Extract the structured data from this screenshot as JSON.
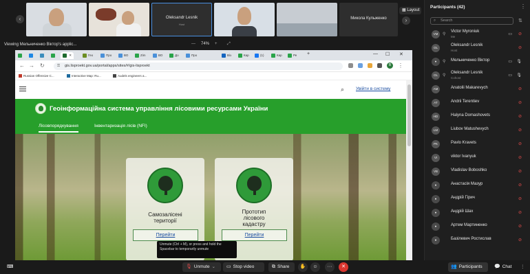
{
  "meeting": {
    "sharing_label": "Viewing Мельниченко Віктор's applic...",
    "zoom_level": "74%",
    "layout_label": "Layout",
    "strip_prev": "‹",
    "strip_next": "›"
  },
  "videos": [
    {
      "name": "",
      "sub": ""
    },
    {
      "name": "",
      "sub": ""
    },
    {
      "name": "",
      "sub": ""
    },
    {
      "name": "Oleksandr Lesnik",
      "sub": "Host"
    },
    {
      "name": "",
      "sub": ""
    },
    {
      "name": "",
      "sub": ""
    },
    {
      "name": "Микола Кульженко",
      "sub": ""
    }
  ],
  "browser": {
    "tabs": [
      {
        "label": "",
        "color": "#2aa44a"
      },
      {
        "label": "",
        "color": "#1e88e5"
      },
      {
        "label": "",
        "color": "#3c8dbc"
      },
      {
        "label": "",
        "color": "#2aa44a"
      },
      {
        "label": "",
        "color": "#1e6b2e"
      },
      {
        "label": "Гео",
        "color": "#6b8e23"
      },
      {
        "label": "Про",
        "color": "#4a90d9"
      },
      {
        "label": "ВО",
        "color": "#4a90d9"
      },
      {
        "label": "Zim",
        "color": "#2aa44a"
      },
      {
        "label": "ВО",
        "color": "#4a90d9"
      },
      {
        "label": "До",
        "color": "#2aa44a"
      },
      {
        "label": "Про",
        "color": "#4a90d9"
      },
      {
        "label": "Віз",
        "color": "#1565c0"
      },
      {
        "label": "Кар",
        "color": "#2aa44a"
      },
      {
        "label": "(1)",
        "color": "#1877f2"
      },
      {
        "label": "Кар",
        "color": "#2aa44a"
      },
      {
        "label": "Ре",
        "color": "#2aa44a"
      }
    ],
    "url": "gis.lisproekt.gov.ua/portal/apps/sites/#/gis-lisproekt",
    "bookmarks": [
      {
        "label": "Russian Offensive C...",
        "color": "#c0392b"
      },
      {
        "label": "Interactive Map: Ru...",
        "color": "#1e6b9e"
      },
      {
        "label": "Audels engineers a...",
        "color": "#444444"
      }
    ],
    "nav": {
      "back": "←",
      "forward": "→",
      "reload": "↻",
      "lock": "🔒"
    },
    "window": {
      "minimize": "—",
      "maximize": "☐",
      "close": "✕"
    },
    "profile_letter": "B"
  },
  "site": {
    "login_link": "Увійти в систему",
    "title": "Геоінформаційна система управління лісовими ресурсами України",
    "nav_tabs": [
      "Лісовпорядкування",
      "Інвентаризація лісів (NFI)"
    ],
    "cards": [
      {
        "title": "Самозалісені\nтериторії",
        "button": "Перейти"
      },
      {
        "title": "Прототип\nлісового\nкадастру",
        "button": "Перейти"
      }
    ],
    "brand_color": "#279f2b"
  },
  "tooltip": {
    "text": "Unmute (Ctrl + M), or press and hold the Spacebar to temporarily unmute"
  },
  "toolbar": {
    "caption_icon": "⌨",
    "unmute": "Unmute",
    "stop_video": "Stop video",
    "share": "Share",
    "participants": "Participants",
    "chat": "Chat",
    "more": "···",
    "leave_icon": "✕"
  },
  "panel": {
    "title": "Participants (42)",
    "search_placeholder": "Search",
    "participants": [
      {
        "initials": "VM",
        "name": "Victor Myroniuk",
        "role": "Me",
        "muted": true,
        "cam": true
      },
      {
        "initials": "OL",
        "name": "Oleksandr Lesnik",
        "role": "Host",
        "muted": true,
        "cam": false
      },
      {
        "initials": "",
        "name": "Мельниченко Віктор",
        "role": "",
        "muted": false,
        "cam": true
      },
      {
        "initials": "OL",
        "name": "Oleksandr Lesnik",
        "role": "Cohost",
        "muted": false,
        "cam": true
      },
      {
        "initials": "AM",
        "name": "Anatolii Makarevych",
        "role": "",
        "muted": true,
        "cam": false
      },
      {
        "initials": "AT",
        "name": "Andrii Terentiev",
        "role": "",
        "muted": true,
        "cam": false
      },
      {
        "initials": "HD",
        "name": "Halyna Domashovets",
        "role": "",
        "muted": true,
        "cam": false
      },
      {
        "initials": "LM",
        "name": "Liubov Matushevych",
        "role": "",
        "muted": true,
        "cam": false
      },
      {
        "initials": "PK",
        "name": "Pavlo Kravets",
        "role": "",
        "muted": true,
        "cam": false
      },
      {
        "initials": "VI",
        "name": "viktor Ivanyuk",
        "role": "",
        "muted": true,
        "cam": false
      },
      {
        "initials": "VB",
        "name": "Vladislav Boboshko",
        "role": "",
        "muted": true,
        "cam": false
      },
      {
        "initials": "",
        "name": "Анастасія Мазур",
        "role": "",
        "muted": true,
        "cam": false
      },
      {
        "initials": "",
        "name": "Андрій Гірич",
        "role": "",
        "muted": true,
        "cam": false
      },
      {
        "initials": "",
        "name": "Андрій Шах",
        "role": "",
        "muted": true,
        "cam": false
      },
      {
        "initials": "",
        "name": "Артем Мартиненко",
        "role": "",
        "muted": true,
        "cam": false
      },
      {
        "initials": "",
        "name": "Базілевич Ростислав",
        "role": "",
        "muted": true,
        "cam": false
      },
      {
        "initials": "",
        "name": "",
        "role": "",
        "muted": true,
        "cam": false
      }
    ]
  }
}
